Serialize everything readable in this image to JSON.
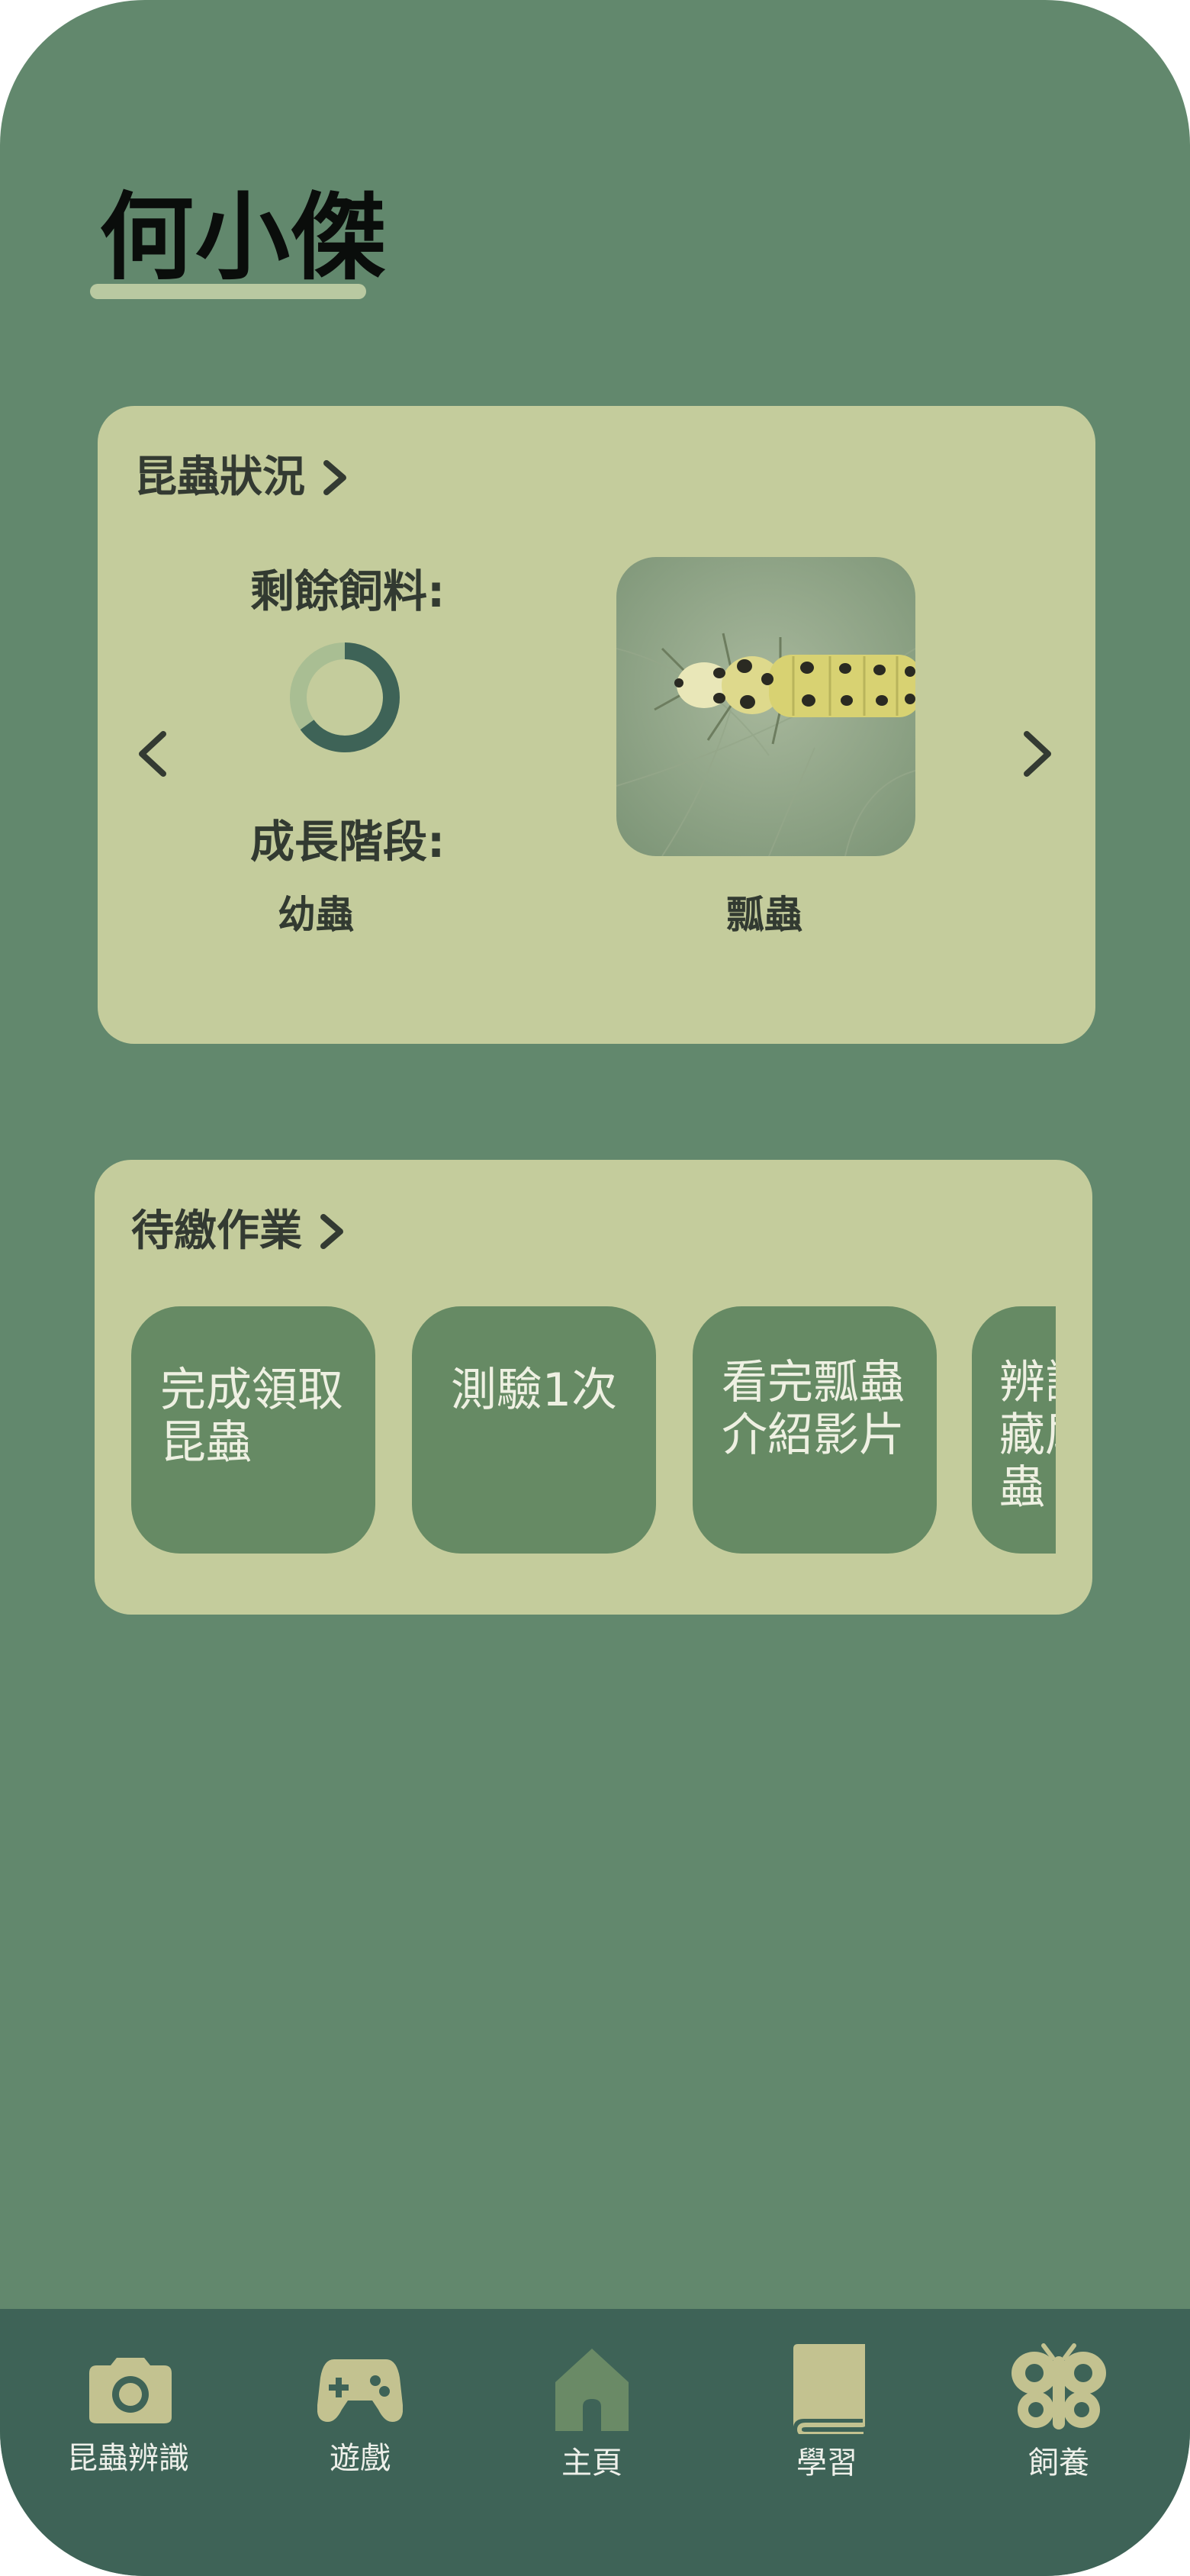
{
  "user": {
    "name": "何小傑"
  },
  "insect_status": {
    "title": "昆蟲狀況",
    "food_label": "剩餘飼料:",
    "food_level": 0.65,
    "growth_label": "成長階段:",
    "growth_value": "幼蟲",
    "insect_name": "瓢蟲"
  },
  "homework": {
    "title": "待繳作業",
    "tasks": [
      {
        "label": "完成領取\n昆蟲"
      },
      {
        "label": "測驗1次"
      },
      {
        "label": "看完瓢蟲\n介紹影片"
      },
      {
        "label": "辨識\n藏尾\n蟲"
      }
    ]
  },
  "nav": {
    "items": [
      {
        "label": "昆蟲辨識",
        "icon": "camera-icon"
      },
      {
        "label": "遊戲",
        "icon": "gamepad-icon"
      },
      {
        "label": "主頁",
        "icon": "home-icon"
      },
      {
        "label": "學習",
        "icon": "book-icon"
      },
      {
        "label": "飼養",
        "icon": "butterfly-icon"
      }
    ],
    "active": 2
  },
  "colors": {
    "background": "#62886d",
    "card": "#c4cc9c",
    "task": "#668a64",
    "nav_bar": "#3e6357",
    "nav_icon": "#c3c290",
    "nav_icon_active": "#6a8a66"
  }
}
